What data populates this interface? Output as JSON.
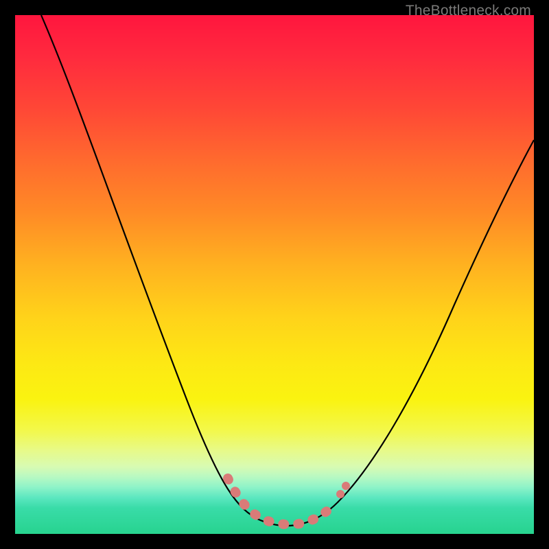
{
  "watermark": "TheBottleneck.com",
  "chart_data": {
    "type": "line",
    "title": "",
    "xlabel": "",
    "ylabel": "",
    "xlim": [
      0,
      100
    ],
    "ylim": [
      0,
      100
    ],
    "grid": false,
    "series": [
      {
        "name": "bottleneck-curve",
        "x": [
          5,
          10,
          15,
          20,
          25,
          30,
          35,
          40,
          43,
          46,
          49,
          52,
          55,
          58,
          61,
          64,
          70,
          76,
          82,
          88,
          94,
          100
        ],
        "values": [
          100,
          84,
          70,
          57,
          45,
          34,
          24,
          15,
          9,
          5,
          2,
          0,
          0,
          0,
          1,
          4,
          11,
          20,
          31,
          44,
          58,
          70
        ]
      }
    ],
    "highlight_band": {
      "x_range": [
        43,
        61
      ],
      "color": "#d97b78",
      "note": "sweet-spot region shown with dotted coral band along curve minimum"
    },
    "background_gradient": {
      "stops": [
        {
          "pos": 0,
          "color": "#ff163e"
        },
        {
          "pos": 50,
          "color": "#ffd21a"
        },
        {
          "pos": 80,
          "color": "#f3f84a"
        },
        {
          "pos": 100,
          "color": "#27d38f"
        }
      ]
    }
  }
}
